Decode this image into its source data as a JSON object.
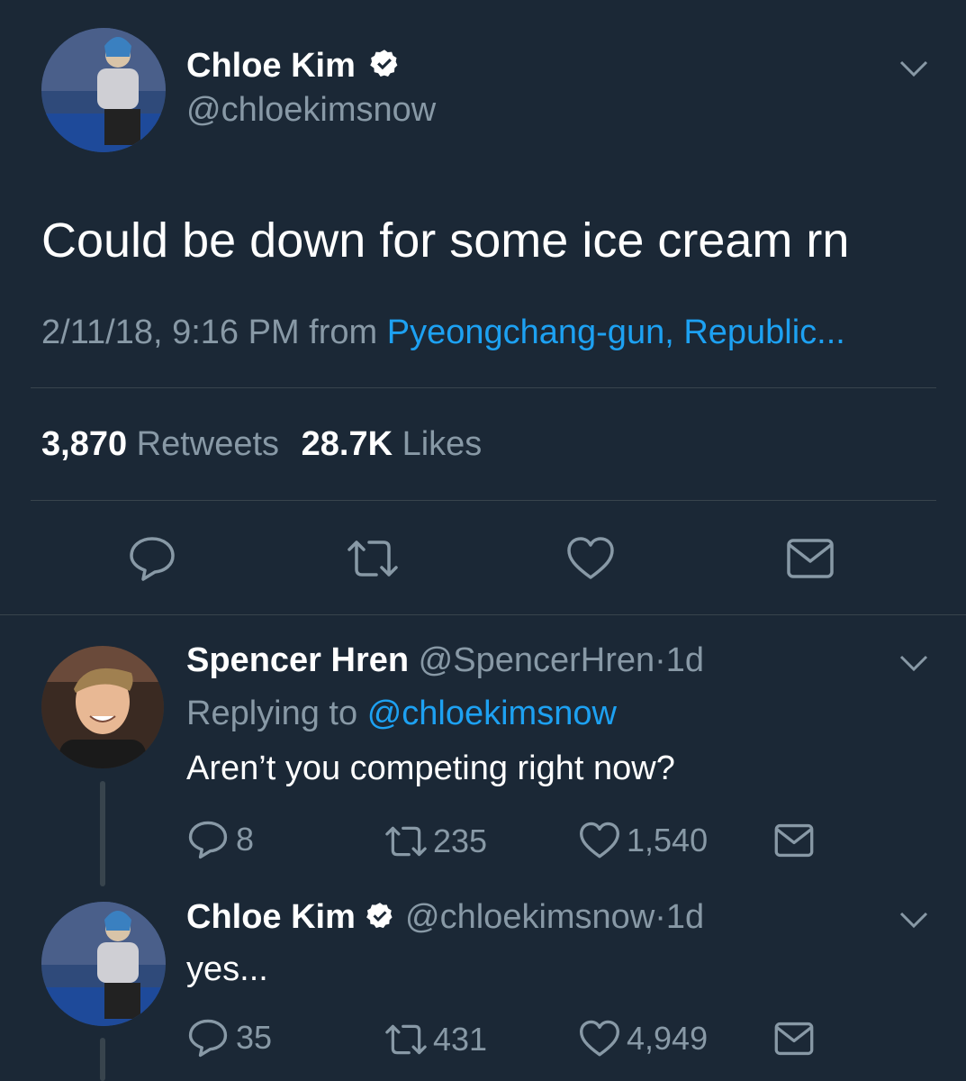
{
  "main_tweet": {
    "display_name": "Chloe Kim",
    "handle": "@chloekimsnow",
    "text": "Could be down for some ice cream rn",
    "timestamp": "2/11/18, 9:16 PM",
    "from_label": "from",
    "location": "Pyeongchang-gun, Republic...",
    "retweet_count": "3,870",
    "retweet_label": "Retweets",
    "like_count": "28.7K",
    "like_label": "Likes"
  },
  "replies": [
    {
      "display_name": "Spencer Hren",
      "handle": "@SpencerHren",
      "sep": "·",
      "time": "1d",
      "replying_label": "Replying to",
      "replying_handle": "@chloekimsnow",
      "text": "Aren’t you competing right now?",
      "reply_count": "8",
      "retweet_count": "235",
      "like_count": "1,540"
    },
    {
      "display_name": "Chloe Kim",
      "handle": "@chloekimsnow",
      "sep": "·",
      "time": "1d",
      "text": "yes...",
      "reply_count": "35",
      "retweet_count": "431",
      "like_count": "4,949"
    }
  ],
  "colors": {
    "background": "#1b2836",
    "link": "#1da1f2",
    "muted": "#8899a6",
    "divider": "#38444d"
  },
  "icons": [
    "verified-badge-icon",
    "chevron-down-icon",
    "reply-icon",
    "retweet-icon",
    "like-icon",
    "share-icon"
  ]
}
